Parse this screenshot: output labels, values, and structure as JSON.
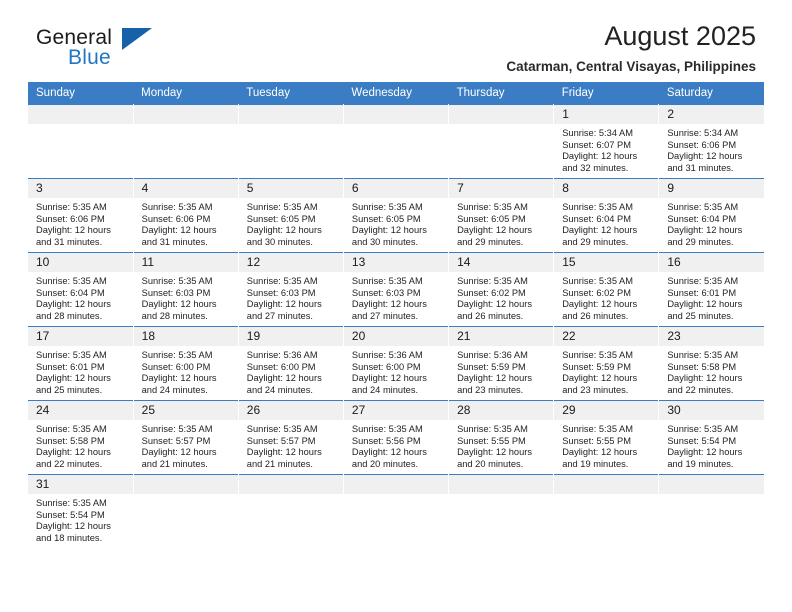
{
  "brand": {
    "line1": "General",
    "line2": "Blue",
    "triangle_color": "#1761a8"
  },
  "header": {
    "title": "August 2025",
    "subtitle": "Catarman, Central Visayas, Philippines"
  },
  "colors": {
    "header_blue": "#3b7dc4",
    "daynum_band": "#f0f0f0",
    "text": "#232323"
  },
  "weekday_headers": [
    "Sunday",
    "Monday",
    "Tuesday",
    "Wednesday",
    "Thursday",
    "Friday",
    "Saturday"
  ],
  "weeks": [
    [
      {
        "day": "",
        "sunrise": "",
        "sunset": "",
        "daylight1": "",
        "daylight2": ""
      },
      {
        "day": "",
        "sunrise": "",
        "sunset": "",
        "daylight1": "",
        "daylight2": ""
      },
      {
        "day": "",
        "sunrise": "",
        "sunset": "",
        "daylight1": "",
        "daylight2": ""
      },
      {
        "day": "",
        "sunrise": "",
        "sunset": "",
        "daylight1": "",
        "daylight2": ""
      },
      {
        "day": "",
        "sunrise": "",
        "sunset": "",
        "daylight1": "",
        "daylight2": ""
      },
      {
        "day": "1",
        "sunrise": "Sunrise: 5:34 AM",
        "sunset": "Sunset: 6:07 PM",
        "daylight1": "Daylight: 12 hours",
        "daylight2": "and 32 minutes."
      },
      {
        "day": "2",
        "sunrise": "Sunrise: 5:34 AM",
        "sunset": "Sunset: 6:06 PM",
        "daylight1": "Daylight: 12 hours",
        "daylight2": "and 31 minutes."
      }
    ],
    [
      {
        "day": "3",
        "sunrise": "Sunrise: 5:35 AM",
        "sunset": "Sunset: 6:06 PM",
        "daylight1": "Daylight: 12 hours",
        "daylight2": "and 31 minutes."
      },
      {
        "day": "4",
        "sunrise": "Sunrise: 5:35 AM",
        "sunset": "Sunset: 6:06 PM",
        "daylight1": "Daylight: 12 hours",
        "daylight2": "and 31 minutes."
      },
      {
        "day": "5",
        "sunrise": "Sunrise: 5:35 AM",
        "sunset": "Sunset: 6:05 PM",
        "daylight1": "Daylight: 12 hours",
        "daylight2": "and 30 minutes."
      },
      {
        "day": "6",
        "sunrise": "Sunrise: 5:35 AM",
        "sunset": "Sunset: 6:05 PM",
        "daylight1": "Daylight: 12 hours",
        "daylight2": "and 30 minutes."
      },
      {
        "day": "7",
        "sunrise": "Sunrise: 5:35 AM",
        "sunset": "Sunset: 6:05 PM",
        "daylight1": "Daylight: 12 hours",
        "daylight2": "and 29 minutes."
      },
      {
        "day": "8",
        "sunrise": "Sunrise: 5:35 AM",
        "sunset": "Sunset: 6:04 PM",
        "daylight1": "Daylight: 12 hours",
        "daylight2": "and 29 minutes."
      },
      {
        "day": "9",
        "sunrise": "Sunrise: 5:35 AM",
        "sunset": "Sunset: 6:04 PM",
        "daylight1": "Daylight: 12 hours",
        "daylight2": "and 29 minutes."
      }
    ],
    [
      {
        "day": "10",
        "sunrise": "Sunrise: 5:35 AM",
        "sunset": "Sunset: 6:04 PM",
        "daylight1": "Daylight: 12 hours",
        "daylight2": "and 28 minutes."
      },
      {
        "day": "11",
        "sunrise": "Sunrise: 5:35 AM",
        "sunset": "Sunset: 6:03 PM",
        "daylight1": "Daylight: 12 hours",
        "daylight2": "and 28 minutes."
      },
      {
        "day": "12",
        "sunrise": "Sunrise: 5:35 AM",
        "sunset": "Sunset: 6:03 PM",
        "daylight1": "Daylight: 12 hours",
        "daylight2": "and 27 minutes."
      },
      {
        "day": "13",
        "sunrise": "Sunrise: 5:35 AM",
        "sunset": "Sunset: 6:03 PM",
        "daylight1": "Daylight: 12 hours",
        "daylight2": "and 27 minutes."
      },
      {
        "day": "14",
        "sunrise": "Sunrise: 5:35 AM",
        "sunset": "Sunset: 6:02 PM",
        "daylight1": "Daylight: 12 hours",
        "daylight2": "and 26 minutes."
      },
      {
        "day": "15",
        "sunrise": "Sunrise: 5:35 AM",
        "sunset": "Sunset: 6:02 PM",
        "daylight1": "Daylight: 12 hours",
        "daylight2": "and 26 minutes."
      },
      {
        "day": "16",
        "sunrise": "Sunrise: 5:35 AM",
        "sunset": "Sunset: 6:01 PM",
        "daylight1": "Daylight: 12 hours",
        "daylight2": "and 25 minutes."
      }
    ],
    [
      {
        "day": "17",
        "sunrise": "Sunrise: 5:35 AM",
        "sunset": "Sunset: 6:01 PM",
        "daylight1": "Daylight: 12 hours",
        "daylight2": "and 25 minutes."
      },
      {
        "day": "18",
        "sunrise": "Sunrise: 5:35 AM",
        "sunset": "Sunset: 6:00 PM",
        "daylight1": "Daylight: 12 hours",
        "daylight2": "and 24 minutes."
      },
      {
        "day": "19",
        "sunrise": "Sunrise: 5:36 AM",
        "sunset": "Sunset: 6:00 PM",
        "daylight1": "Daylight: 12 hours",
        "daylight2": "and 24 minutes."
      },
      {
        "day": "20",
        "sunrise": "Sunrise: 5:36 AM",
        "sunset": "Sunset: 6:00 PM",
        "daylight1": "Daylight: 12 hours",
        "daylight2": "and 24 minutes."
      },
      {
        "day": "21",
        "sunrise": "Sunrise: 5:36 AM",
        "sunset": "Sunset: 5:59 PM",
        "daylight1": "Daylight: 12 hours",
        "daylight2": "and 23 minutes."
      },
      {
        "day": "22",
        "sunrise": "Sunrise: 5:35 AM",
        "sunset": "Sunset: 5:59 PM",
        "daylight1": "Daylight: 12 hours",
        "daylight2": "and 23 minutes."
      },
      {
        "day": "23",
        "sunrise": "Sunrise: 5:35 AM",
        "sunset": "Sunset: 5:58 PM",
        "daylight1": "Daylight: 12 hours",
        "daylight2": "and 22 minutes."
      }
    ],
    [
      {
        "day": "24",
        "sunrise": "Sunrise: 5:35 AM",
        "sunset": "Sunset: 5:58 PM",
        "daylight1": "Daylight: 12 hours",
        "daylight2": "and 22 minutes."
      },
      {
        "day": "25",
        "sunrise": "Sunrise: 5:35 AM",
        "sunset": "Sunset: 5:57 PM",
        "daylight1": "Daylight: 12 hours",
        "daylight2": "and 21 minutes."
      },
      {
        "day": "26",
        "sunrise": "Sunrise: 5:35 AM",
        "sunset": "Sunset: 5:57 PM",
        "daylight1": "Daylight: 12 hours",
        "daylight2": "and 21 minutes."
      },
      {
        "day": "27",
        "sunrise": "Sunrise: 5:35 AM",
        "sunset": "Sunset: 5:56 PM",
        "daylight1": "Daylight: 12 hours",
        "daylight2": "and 20 minutes."
      },
      {
        "day": "28",
        "sunrise": "Sunrise: 5:35 AM",
        "sunset": "Sunset: 5:55 PM",
        "daylight1": "Daylight: 12 hours",
        "daylight2": "and 20 minutes."
      },
      {
        "day": "29",
        "sunrise": "Sunrise: 5:35 AM",
        "sunset": "Sunset: 5:55 PM",
        "daylight1": "Daylight: 12 hours",
        "daylight2": "and 19 minutes."
      },
      {
        "day": "30",
        "sunrise": "Sunrise: 5:35 AM",
        "sunset": "Sunset: 5:54 PM",
        "daylight1": "Daylight: 12 hours",
        "daylight2": "and 19 minutes."
      }
    ],
    [
      {
        "day": "31",
        "sunrise": "Sunrise: 5:35 AM",
        "sunset": "Sunset: 5:54 PM",
        "daylight1": "Daylight: 12 hours",
        "daylight2": "and 18 minutes."
      },
      {
        "day": "",
        "sunrise": "",
        "sunset": "",
        "daylight1": "",
        "daylight2": ""
      },
      {
        "day": "",
        "sunrise": "",
        "sunset": "",
        "daylight1": "",
        "daylight2": ""
      },
      {
        "day": "",
        "sunrise": "",
        "sunset": "",
        "daylight1": "",
        "daylight2": ""
      },
      {
        "day": "",
        "sunrise": "",
        "sunset": "",
        "daylight1": "",
        "daylight2": ""
      },
      {
        "day": "",
        "sunrise": "",
        "sunset": "",
        "daylight1": "",
        "daylight2": ""
      },
      {
        "day": "",
        "sunrise": "",
        "sunset": "",
        "daylight1": "",
        "daylight2": ""
      }
    ]
  ]
}
